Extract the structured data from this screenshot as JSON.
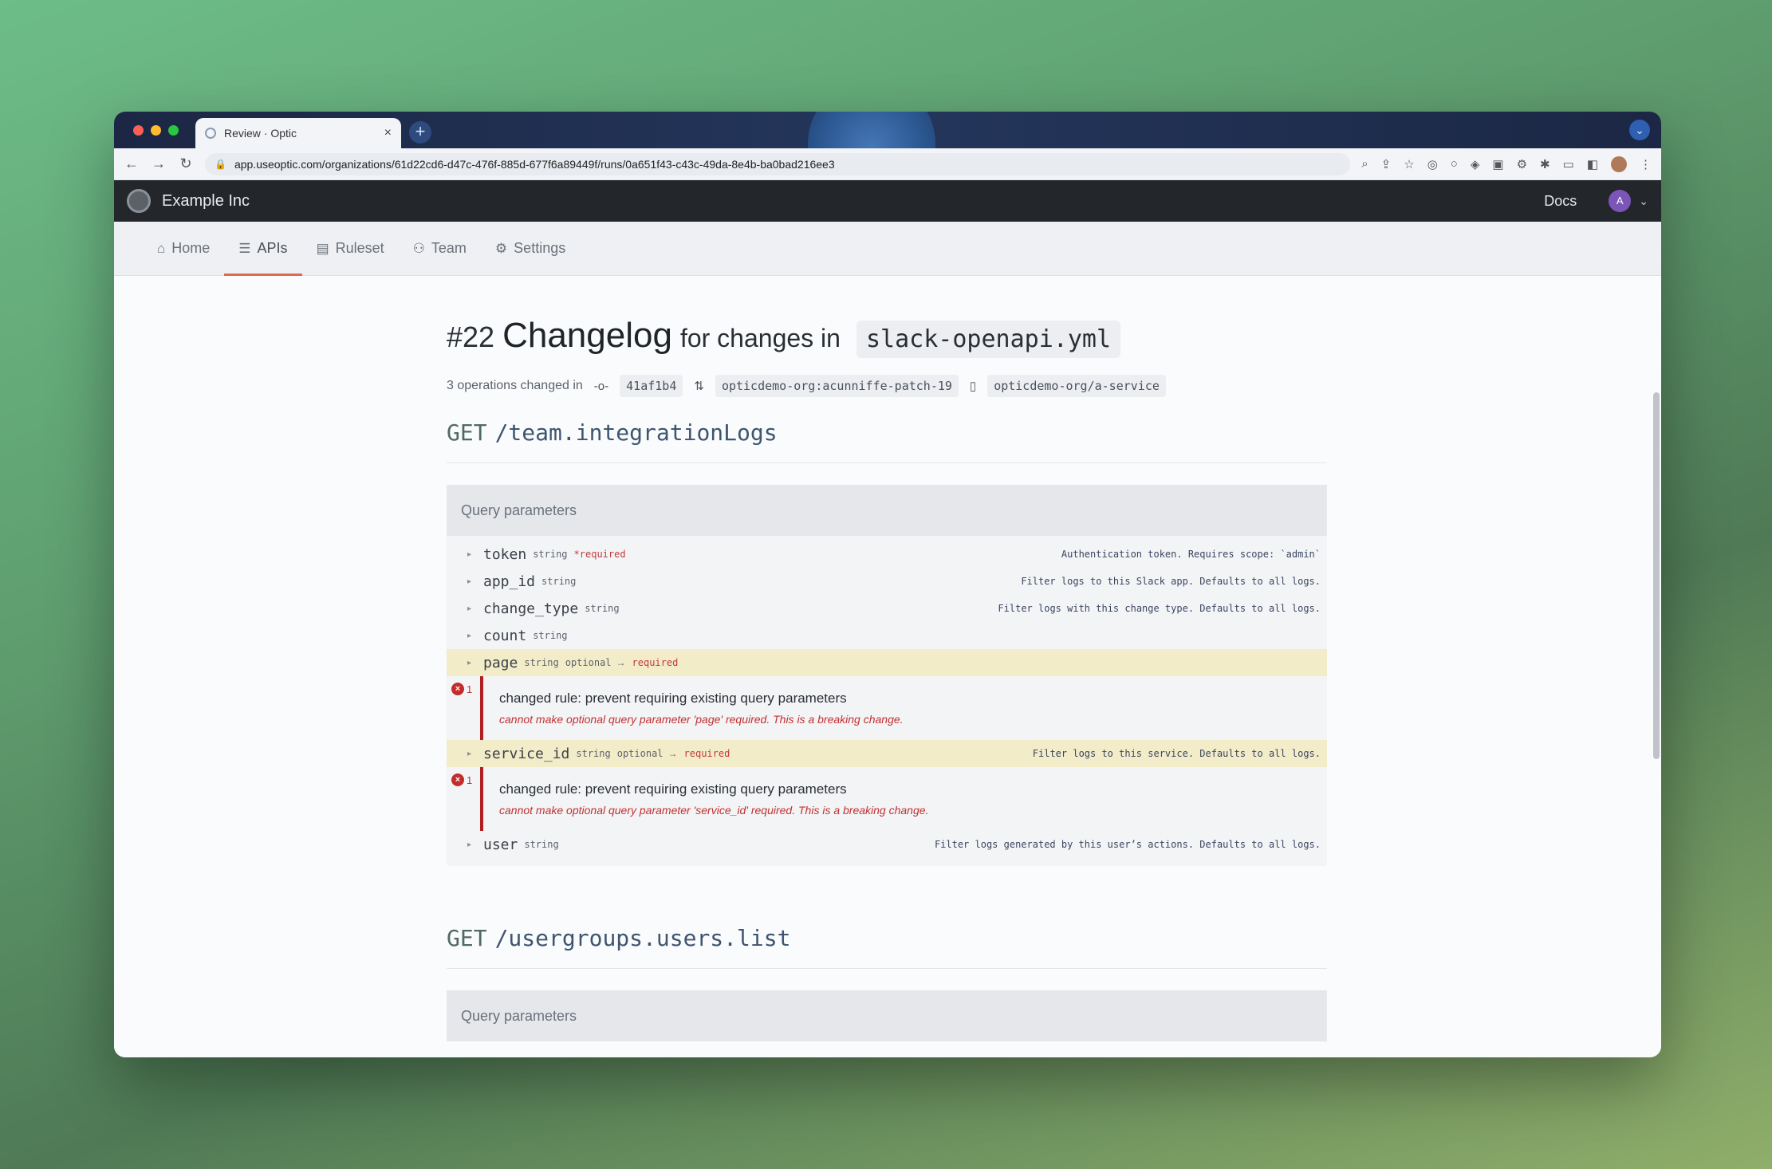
{
  "browser": {
    "tab_title": "Review · Optic",
    "new_tab": "+",
    "url": "app.useoptic.com/organizations/61d22cd6-d47c-476f-885d-677f6a89449f/runs/0a651f43-c43c-49da-8e4b-ba0bad216ee3"
  },
  "app": {
    "org_name": "Example Inc",
    "docs_label": "Docs",
    "avatar_initial": "A"
  },
  "nav": {
    "items": [
      {
        "label": "Home",
        "icon": "home-icon"
      },
      {
        "label": "APIs",
        "icon": "api-list-icon",
        "active": true
      },
      {
        "label": "Ruleset",
        "icon": "ruleset-icon"
      },
      {
        "label": "Team",
        "icon": "team-icon"
      },
      {
        "label": "Settings",
        "icon": "gear-icon"
      }
    ]
  },
  "page": {
    "number": "#22",
    "title": "Changelog",
    "title_suffix": "for changes in",
    "file": "slack-openapi.yml",
    "meta_text": "3 operations changed in",
    "commit": "41af1b4",
    "branch": "opticdemo-org:acunniffe-patch-19",
    "repo": "opticdemo-org/a-service"
  },
  "endpoints": [
    {
      "method": "GET",
      "path": "/team.integrationLogs",
      "section_title": "Query parameters",
      "params": [
        {
          "name": "token",
          "type": "string",
          "required": "*required",
          "desc": "Authentication token. Requires scope: `admin`"
        },
        {
          "name": "app_id",
          "type": "string",
          "desc": "Filter logs to this Slack app. Defaults to all logs."
        },
        {
          "name": "change_type",
          "type": "string",
          "desc": "Filter logs with this change type. Defaults to all logs."
        },
        {
          "name": "count",
          "type": "string",
          "desc": ""
        },
        {
          "name": "page",
          "type": "string",
          "optional": "optional",
          "arrow": "→",
          "to": "required",
          "desc": ""
        },
        {
          "name": "service_id",
          "type": "string",
          "optional": "optional",
          "arrow": "→",
          "to": "required",
          "desc": "Filter logs to this service. Defaults to all logs."
        },
        {
          "name": "user",
          "type": "string",
          "desc": "Filter logs generated by this user’s actions. Defaults to all logs."
        }
      ],
      "issues": [
        {
          "count": "1",
          "title": "changed rule: prevent requiring existing query parameters",
          "message": "cannot make optional query parameter 'page' required. This is a breaking change."
        },
        {
          "count": "1",
          "title": "changed rule: prevent requiring existing query parameters",
          "message": "cannot make optional query parameter 'service_id' required. This is a breaking change."
        }
      ]
    },
    {
      "method": "GET",
      "path": "/usergroups.users.list",
      "section_title": "Query parameters"
    }
  ],
  "colors": {
    "accent": "#e06a4e",
    "error": "#c42b2b",
    "highlight": "#f3ecc8"
  }
}
